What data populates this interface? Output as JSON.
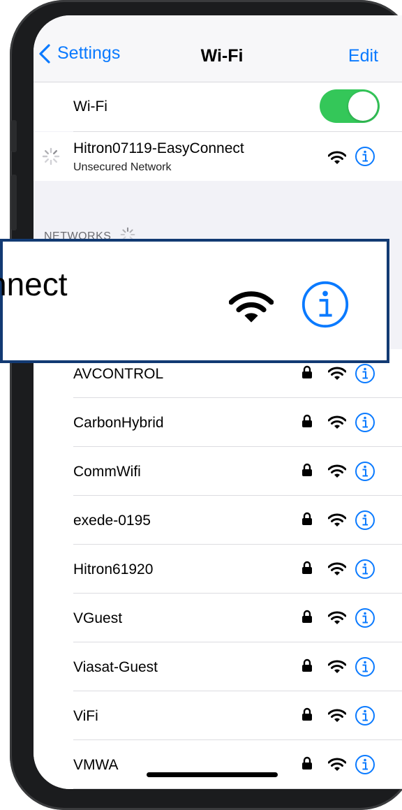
{
  "navbar": {
    "back_label": "Settings",
    "title": "Wi-Fi",
    "edit_label": "Edit"
  },
  "wifi_toggle": {
    "label": "Wi-Fi",
    "on": true,
    "color": "#34c759"
  },
  "connecting": {
    "name": "Hitron07119-EasyConnect",
    "subtitle": "Unsecured Network"
  },
  "networks_header": "NETWORKS",
  "zoom_callout": {
    "text": "nnect"
  },
  "networks": [
    {
      "name": "AVCONTROL",
      "locked": true
    },
    {
      "name": "CarbonHybrid",
      "locked": true
    },
    {
      "name": "CommWifi",
      "locked": true
    },
    {
      "name": "exede-0195",
      "locked": true
    },
    {
      "name": "Hitron61920",
      "locked": true
    },
    {
      "name": "VGuest",
      "locked": true
    },
    {
      "name": "Viasat-Guest",
      "locked": true
    },
    {
      "name": "ViFi",
      "locked": true
    },
    {
      "name": "VMWA",
      "locked": true
    }
  ],
  "colors": {
    "accent": "#0a7aff",
    "toggle_on": "#34c759",
    "callout_border": "#123a73"
  }
}
